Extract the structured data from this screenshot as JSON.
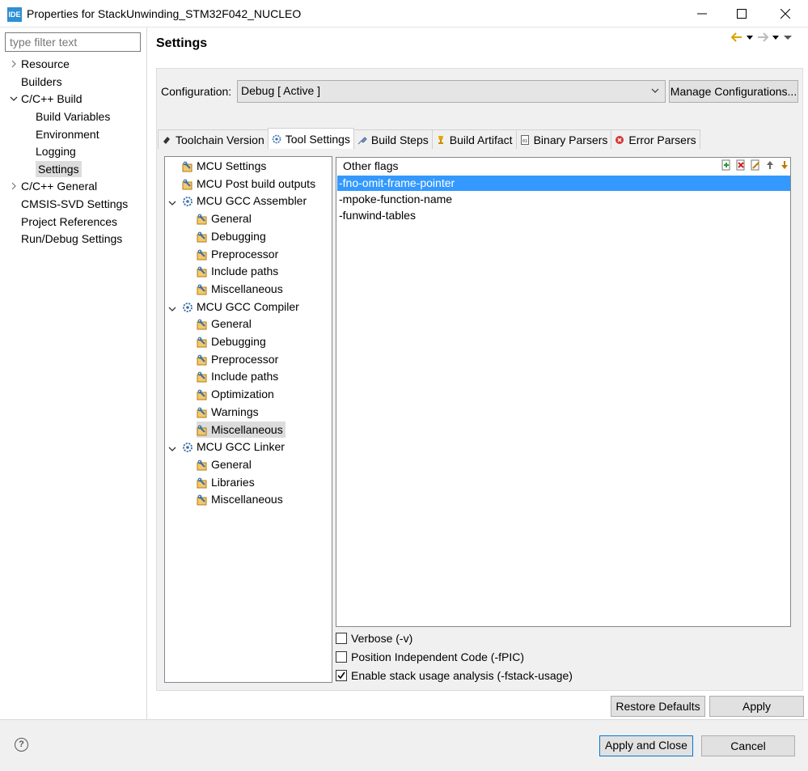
{
  "window": {
    "app_icon": "IDE",
    "title": "Properties for StackUnwinding_STM32F042_NUCLEO"
  },
  "filter": {
    "placeholder": "type filter text"
  },
  "nav": {
    "items": [
      {
        "label": "Resource",
        "arrow": "right"
      },
      {
        "label": "Builders"
      },
      {
        "label": "C/C++ Build",
        "arrow": "down"
      },
      {
        "label": "Build Variables"
      },
      {
        "label": "Environment"
      },
      {
        "label": "Logging"
      },
      {
        "label": "Settings",
        "selected": true
      },
      {
        "label": "C/C++ General",
        "arrow": "right"
      },
      {
        "label": "CMSIS-SVD Settings"
      },
      {
        "label": "Project References"
      },
      {
        "label": "Run/Debug Settings"
      }
    ]
  },
  "page": {
    "title": "Settings"
  },
  "config": {
    "label": "Configuration:",
    "value": "Debug  [ Active ]",
    "manage_label": "Manage Configurations..."
  },
  "tabs": [
    {
      "label": "Toolchain  Version",
      "icon": "toolchain-icon"
    },
    {
      "label": "Tool Settings",
      "icon": "gear-icon",
      "active": true
    },
    {
      "label": "Build Steps",
      "icon": "build-steps-icon"
    },
    {
      "label": "Build Artifact",
      "icon": "trophy-icon"
    },
    {
      "label": "Binary Parsers",
      "icon": "binary-icon"
    },
    {
      "label": "Error Parsers",
      "icon": "error-icon"
    }
  ],
  "tree": {
    "items": [
      {
        "label": "MCU Settings",
        "level": 1,
        "icon": "option-icon"
      },
      {
        "label": "MCU Post build outputs",
        "level": 1,
        "icon": "option-icon"
      },
      {
        "label": "MCU GCC Assembler",
        "level": 0,
        "icon": "gear-icon",
        "expanded": true
      },
      {
        "label": "General",
        "level": 2,
        "icon": "option-icon"
      },
      {
        "label": "Debugging",
        "level": 2,
        "icon": "option-icon"
      },
      {
        "label": "Preprocessor",
        "level": 2,
        "icon": "option-icon"
      },
      {
        "label": "Include paths",
        "level": 2,
        "icon": "option-icon"
      },
      {
        "label": "Miscellaneous",
        "level": 2,
        "icon": "option-icon"
      },
      {
        "label": "MCU GCC Compiler",
        "level": 0,
        "icon": "gear-icon",
        "expanded": true
      },
      {
        "label": "General",
        "level": 2,
        "icon": "option-icon"
      },
      {
        "label": "Debugging",
        "level": 2,
        "icon": "option-icon"
      },
      {
        "label": "Preprocessor",
        "level": 2,
        "icon": "option-icon"
      },
      {
        "label": "Include paths",
        "level": 2,
        "icon": "option-icon"
      },
      {
        "label": "Optimization",
        "level": 2,
        "icon": "option-icon"
      },
      {
        "label": "Warnings",
        "level": 2,
        "icon": "option-icon"
      },
      {
        "label": "Miscellaneous",
        "level": 2,
        "icon": "option-icon",
        "selected": true
      },
      {
        "label": "MCU GCC Linker",
        "level": 0,
        "icon": "gear-icon",
        "expanded": true
      },
      {
        "label": "General",
        "level": 2,
        "icon": "option-icon"
      },
      {
        "label": "Libraries",
        "level": 2,
        "icon": "option-icon"
      },
      {
        "label": "Miscellaneous",
        "level": 2,
        "icon": "option-icon"
      }
    ]
  },
  "flags": {
    "title": "Other flags",
    "tools": [
      "add-icon",
      "delete-icon",
      "edit-icon",
      "move-up-icon",
      "move-down-icon"
    ],
    "items": [
      {
        "value": "-fno-omit-frame-pointer",
        "selected": true
      },
      {
        "value": "-mpoke-function-name"
      },
      {
        "value": "-funwind-tables"
      }
    ]
  },
  "checkboxes": [
    {
      "label": "Verbose (-v)",
      "checked": false
    },
    {
      "label": "Position Independent Code (-fPIC)",
      "checked": false
    },
    {
      "label": "Enable stack usage analysis (-fstack-usage)",
      "checked": true
    }
  ],
  "buttons": {
    "restore": "Restore Defaults",
    "apply": "Apply",
    "apply_close": "Apply and Close",
    "cancel": "Cancel",
    "help": "?"
  },
  "colors": {
    "selection": "#3399ff",
    "default_button_border": "#0078d7"
  }
}
